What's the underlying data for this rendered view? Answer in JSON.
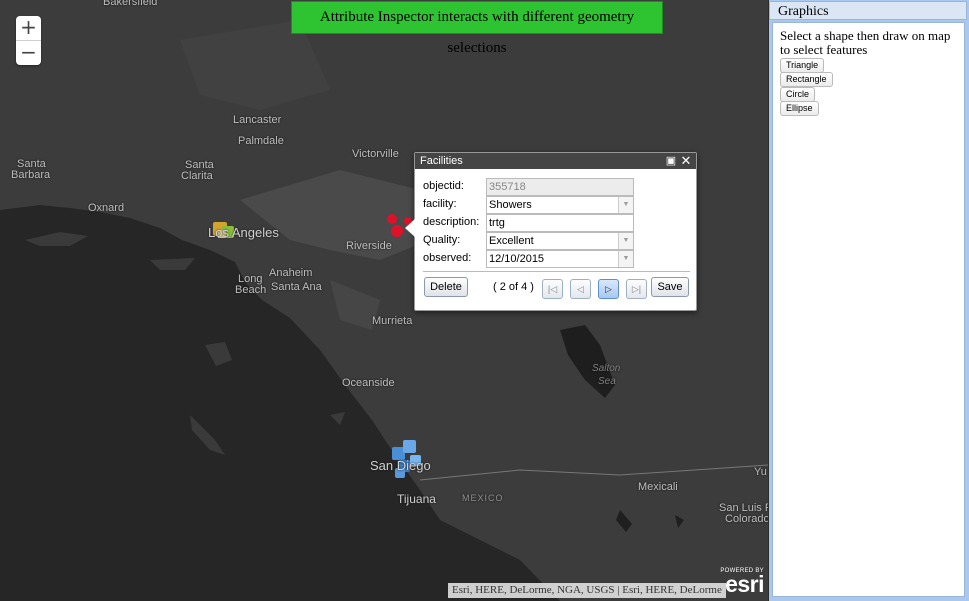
{
  "banner": "Attribute Inspector interacts with different geometry selections",
  "zoom": {
    "in": "+",
    "out": "−"
  },
  "places": {
    "bakersfield": "Bakersfield",
    "lancaster": "Lancaster",
    "palmdale": "Palmdale",
    "santa_barbara_1": "Santa",
    "santa_barbara_2": "Barbara",
    "santa_clarita_1": "Santa",
    "santa_clarita_2": "Clarita",
    "victorville": "Victorville",
    "oxnard": "Oxnard",
    "los_angeles": "Los Angeles",
    "riverside": "Riverside",
    "long_beach_1": "Long",
    "long_beach_2": "Beach",
    "anaheim": "Anaheim",
    "santa_ana": "Santa Ana",
    "murrieta": "Murrieta",
    "salton_sea_1": "Salton",
    "salton_sea_2": "Sea",
    "oceanside": "Oceanside",
    "san_diego": "San Diego",
    "tijuana": "Tijuana",
    "mexico": "MEXICO",
    "mexicali": "Mexicali",
    "yuma": "Yu",
    "san_luis_1": "San Luis R",
    "san_luis_2": "Colorado"
  },
  "popup": {
    "title": "Facilities",
    "fields": {
      "objectid": {
        "label": "objectid:",
        "value": "355718"
      },
      "facility": {
        "label": "facility:",
        "value": "Showers"
      },
      "description": {
        "label": "description:",
        "value": "trtg"
      },
      "quality": {
        "label": "Quality:",
        "value": "Excellent"
      },
      "observed": {
        "label": "observed:",
        "value": "12/10/2015"
      }
    },
    "delete_label": "Delete",
    "counter": "( 2 of 4 )",
    "save_label": "Save"
  },
  "panel": {
    "title": "Graphics",
    "instructions": "Select a shape then draw on map to select features",
    "tools": [
      "Triangle",
      "Rectangle",
      "Circle",
      "Ellipse"
    ]
  },
  "attribution": "Esri, HERE, DeLorme, NGA, USGS | Esri, HERE, DeLorme",
  "esri": {
    "powered": "POWERED BY",
    "name": "esri"
  },
  "colors": {
    "banner": "#2ec431",
    "selection": "#e0102a",
    "map_land": "#3a3a3a",
    "map_water": "#262626",
    "panel_bg": "#a9c8ef"
  }
}
